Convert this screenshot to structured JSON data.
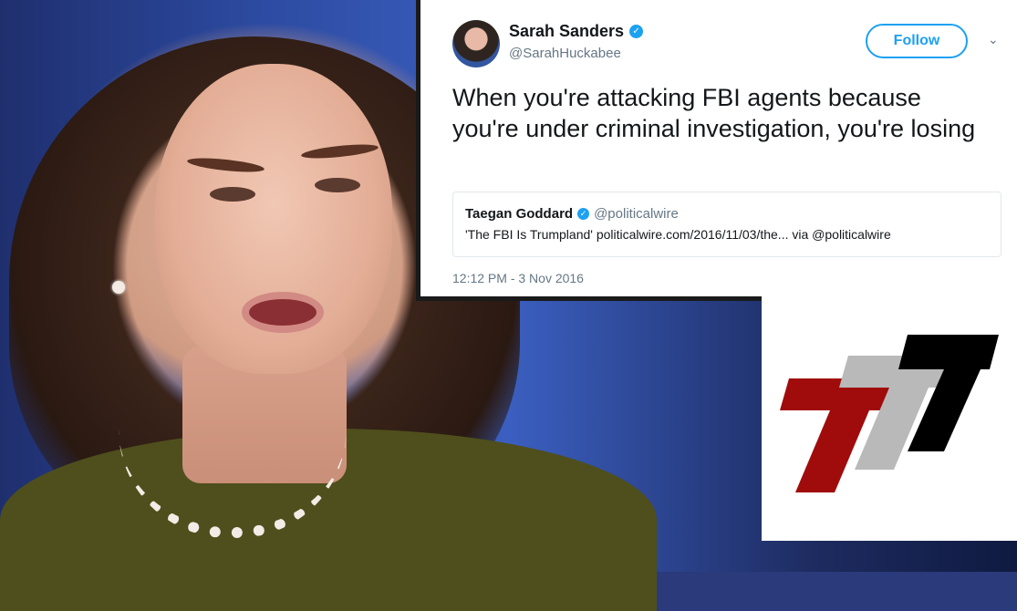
{
  "tweet": {
    "author_name": "Sarah Sanders",
    "author_handle": "@SarahHuckabee",
    "follow_label": "Follow",
    "body": "When you're attacking FBI agents because you're under criminal investigation, you're losing",
    "quoted": {
      "name": "Taegan Goddard",
      "handle": "@politicalwire",
      "text": "'The FBI Is Trumpland' politicalwire.com/2016/11/03/the... via @politicalwire"
    },
    "timestamp": "12:12 PM - 3 Nov 2016"
  },
  "icons": {
    "verified": "verified-badge-icon",
    "menu": "chevron-down-icon"
  },
  "logo": {
    "colors": [
      "#a00c0c",
      "#b9b9b9",
      "#000000"
    ]
  }
}
